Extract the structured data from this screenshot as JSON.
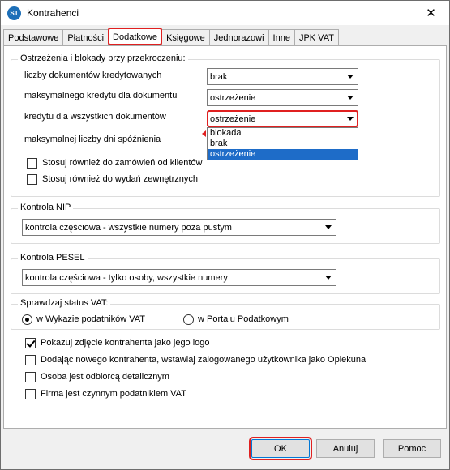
{
  "window": {
    "title": "Kontrahenci",
    "app_icon": "app-icon",
    "close_symbol": "✕"
  },
  "tabs": [
    {
      "label": "Podstawowe"
    },
    {
      "label": "Płatności"
    },
    {
      "label": "Dodatkowe",
      "active": true
    },
    {
      "label": "Księgowe"
    },
    {
      "label": "Jednorazowi"
    },
    {
      "label": "Inne"
    },
    {
      "label": "JPK VAT"
    }
  ],
  "warnings": {
    "title": "Ostrzeżenia i blokady przy przekroczeniu:",
    "rows": [
      {
        "label": "liczby dokumentów kredytowanych",
        "value": "brak"
      },
      {
        "label": "maksymalnego kredytu dla  dokumentu",
        "value": "ostrzeżenie"
      },
      {
        "label": "kredytu dla wszystkich dokumentów",
        "value": "ostrzeżenie"
      },
      {
        "label": "maksymalnej liczby dni spóźnienia",
        "value": ""
      }
    ],
    "dropdown_options": [
      "blokada",
      "brak",
      "ostrzeżenie"
    ],
    "check_orders": "Stosuj również do zamówień od klientów",
    "check_issues": "Stosuj również do wydań zewnętrznych"
  },
  "nip": {
    "title": "Kontrola NIP",
    "value": "kontrola częściowa - wszystkie numery poza pustym"
  },
  "pesel": {
    "title": "Kontrola PESEL",
    "value": "kontrola częściowa - tylko osoby, wszystkie numery"
  },
  "vat": {
    "title": "Sprawdzaj status VAT:",
    "option1": "w Wykazie podatników VAT",
    "option2": "w Portalu Podatkowym"
  },
  "options": {
    "show_photo": "Pokazuj zdjęcie kontrahenta jako jego logo",
    "add_guardian": "Dodając nowego kontrahenta, wstawiaj zalogowanego użytkownika jako Opiekuna",
    "retail": "Osoba jest odbiorcą detalicznym",
    "vat_payer": "Firma jest czynnym podatnikiem VAT"
  },
  "buttons": {
    "ok": "OK",
    "cancel": "Anuluj",
    "help": "Pomoc"
  },
  "colors": {
    "highlight": "#e02020",
    "selection": "#1e6cc8"
  }
}
